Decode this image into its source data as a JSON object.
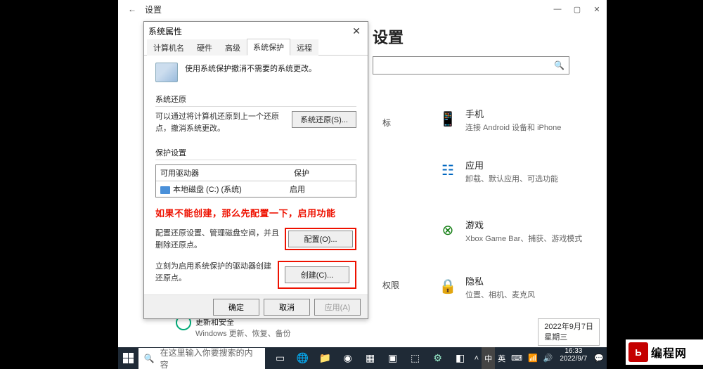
{
  "settings_window": {
    "back_glyph": "←",
    "title": "设置",
    "controls": {
      "min": "—",
      "max": "▢",
      "close": "✕"
    },
    "page_title_fragment": "设置",
    "search_placeholder": " ",
    "search_icon": "🔍",
    "visible_label_1": "标",
    "visible_label_2": "权限",
    "update_title": "更新和安全",
    "update_sub": "Windows 更新、恢复、备份",
    "items": [
      {
        "icon": "📱",
        "title": "手机",
        "sub": "连接 Android 设备和 iPhone"
      },
      {
        "icon": "☷",
        "title": "应用",
        "sub": "卸载、默认应用、可选功能"
      },
      {
        "icon": "⊗",
        "title": "游戏",
        "sub": "Xbox Game Bar、捕获、游戏模式"
      },
      {
        "icon": "🔒",
        "title": "隐私",
        "sub": "位置、相机、麦克风"
      }
    ]
  },
  "dialog": {
    "title": "系统属性",
    "close_glyph": "✕",
    "tabs": [
      "计算机名",
      "硬件",
      "高级",
      "系统保护",
      "远程"
    ],
    "active_tab": 3,
    "info_line": "使用系统保护撤消不需要的系统更改。",
    "section_restore": {
      "head": "系统还原",
      "desc": "可以通过将计算机还原到上一个还原点，撤消系统更改。",
      "button": "系统还原(S)..."
    },
    "section_protect": {
      "head": "保护设置",
      "col_drive": "可用驱动器",
      "col_prot": "保护",
      "rows": [
        {
          "drive": "本地磁盘 (C:) (系统)",
          "prot": "启用"
        }
      ],
      "annotation": "如果不能创建，那么先配置一下，启用功能",
      "config_desc": "配置还原设置、管理磁盘空间，并且删除还原点。",
      "config_btn": "配置(O)...",
      "create_desc": "立刻为启用系统保护的驱动器创建还原点。",
      "create_btn": "创建(C)..."
    },
    "footer": {
      "ok": "确定",
      "cancel": "取消",
      "apply": "应用(A)"
    }
  },
  "taskbar": {
    "search_placeholder": "在这里输入你要搜索的内容",
    "tray": {
      "ime1": "中",
      "ime2": "英",
      "ime3": "⌨",
      "net": "📶",
      "vol": "🔊",
      "time": "16:33",
      "date": "2022/9/7",
      "notif": "💬"
    },
    "tooltip": {
      "l1": "2022年9月7日",
      "l2": "星期三"
    }
  },
  "watermark": {
    "logo": "Ь",
    "text": "编程网"
  }
}
